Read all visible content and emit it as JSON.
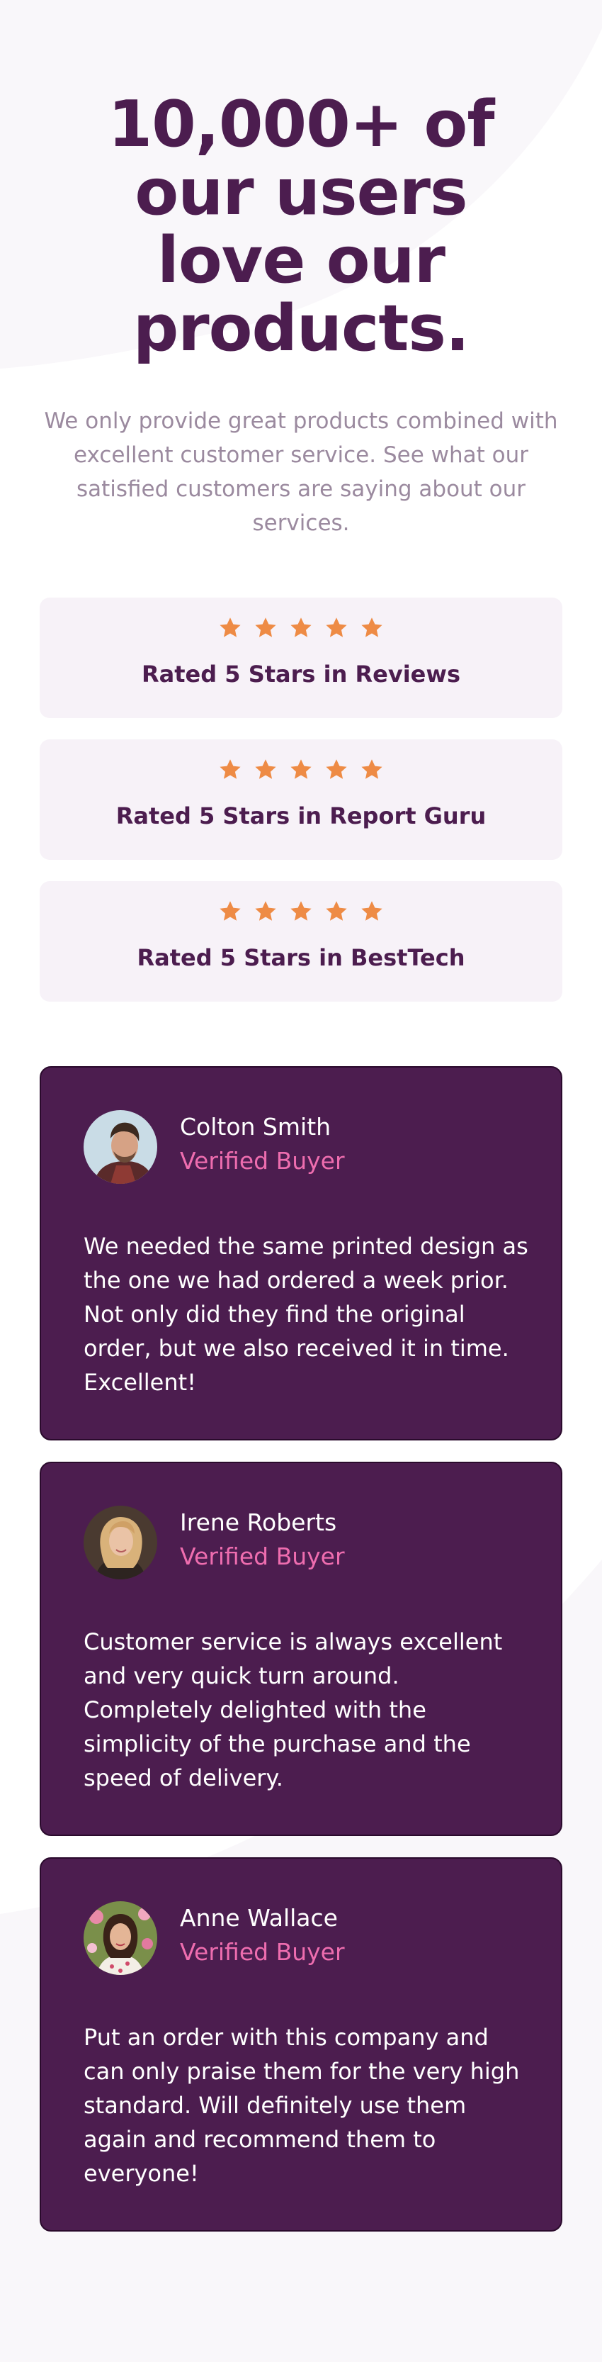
{
  "hero": {
    "headline": "10,000+ of our users love our products.",
    "intro": "We only provide great products combined with excellent customer service. See what our satisfied customers are saying about our services."
  },
  "ratings": [
    {
      "stars": 5,
      "label": "Rated 5 Stars in Reviews"
    },
    {
      "stars": 5,
      "label": "Rated 5 Stars in Report Guru"
    },
    {
      "stars": 5,
      "label": "Rated 5 Stars in BestTech"
    }
  ],
  "reviews": [
    {
      "name": "Colton Smith",
      "role": "Verified Buyer",
      "quote": "We needed the same printed design as the one we had ordered a week prior. Not only did they find the original order, but we also received it in time. Excellent!"
    },
    {
      "name": "Irene Roberts",
      "role": "Verified Buyer",
      "quote": "Customer service is always excellent and very quick turn around. Completely delighted with the simplicity of the purchase and the speed of delivery."
    },
    {
      "name": "Anne Wallace",
      "role": "Verified Buyer",
      "quote": "Put an order with this company and can only praise them for the very high standard. Will definitely use them again and recommend them to everyone!"
    }
  ],
  "colors": {
    "brand_purple": "#4c1d4f",
    "muted_text": "#9b8a9f",
    "accent_pink": "#ee6daf",
    "star_orange": "#ee8b45",
    "rating_card_bg": "#f7f2f8"
  },
  "icons": {
    "star": "star-icon"
  }
}
